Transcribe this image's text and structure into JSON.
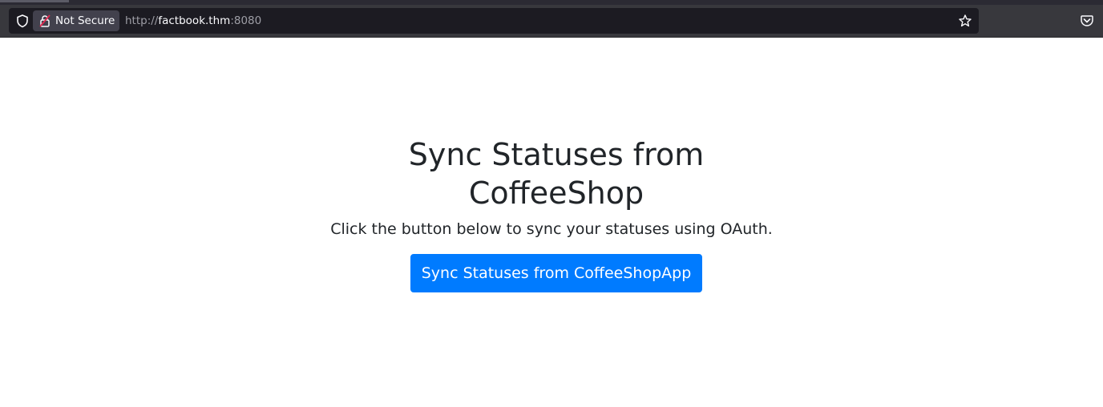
{
  "browser": {
    "security_label": "Not Secure",
    "url_scheme": "http://",
    "url_host": "factbook.thm",
    "url_port": ":8080",
    "icons": {
      "shield": "shield-icon",
      "lock": "insecure-lock-icon",
      "bookmark": "star-icon",
      "pocket": "pocket-icon"
    }
  },
  "page": {
    "heading": "Sync Statuses from CoffeeShop",
    "description": "Click the button below to sync your statuses using OAuth.",
    "sync_button_label": "Sync Statuses from CoffeeShopApp"
  },
  "colors": {
    "button_primary": "#007bff",
    "text": "#212529",
    "toolbar": "#38383d"
  }
}
